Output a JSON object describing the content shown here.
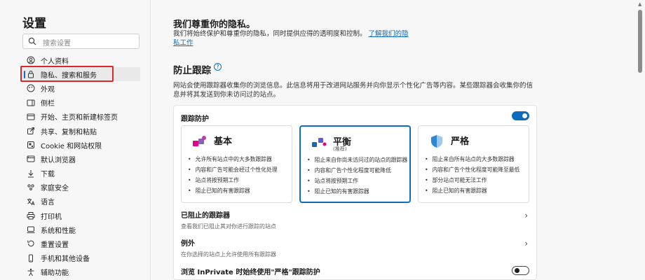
{
  "sidebar": {
    "title": "设置",
    "search_placeholder": "搜索设置",
    "items": [
      {
        "label": "个人资料",
        "icon": "profile-icon"
      },
      {
        "label": "隐私、搜索和服务",
        "icon": "lock-icon",
        "active": true
      },
      {
        "label": "外观",
        "icon": "appearance-icon"
      },
      {
        "label": "侧栏",
        "icon": "sidebar-icon"
      },
      {
        "label": "开始、主页和新建标签页",
        "icon": "home-icon"
      },
      {
        "label": "共享、复制和粘贴",
        "icon": "share-icon"
      },
      {
        "label": "Cookie 和网站权限",
        "icon": "cookie-icon"
      },
      {
        "label": "默认浏览器",
        "icon": "browser-icon"
      },
      {
        "label": "下载",
        "icon": "download-icon"
      },
      {
        "label": "家庭安全",
        "icon": "family-icon"
      },
      {
        "label": "语言",
        "icon": "language-icon"
      },
      {
        "label": "打印机",
        "icon": "printer-icon"
      },
      {
        "label": "系统和性能",
        "icon": "system-icon"
      },
      {
        "label": "重置设置",
        "icon": "reset-icon"
      },
      {
        "label": "手机和其他设备",
        "icon": "phone-icon"
      },
      {
        "label": "辅助功能",
        "icon": "accessibility-icon"
      }
    ]
  },
  "main": {
    "privacy_title": "我们尊重你的隐私。",
    "privacy_desc": "我们将始终保护和尊重你的隐私，同时提供应得的透明度和控制。",
    "privacy_link": "了解我们的隐私工作",
    "tracking_title": "防止跟踪",
    "tracking_help": "?",
    "tracking_desc": "网站会使用跟踪器收集你的浏览信息。此信息将用于改进网站服务并向你显示个性化广告等内容。某些跟踪器会收集你的信息并将其发送到你未访问过的站点。",
    "tracking_protection_label": "跟踪防护",
    "cards": [
      {
        "name": "基本",
        "sub": "",
        "bullets": [
          "允许所有站点中的大多数跟踪器",
          "内容和广告可能会经过个性化处理",
          "站点将按预期工作",
          "阻止已知的有害跟踪器"
        ]
      },
      {
        "name": "平衡",
        "sub": "(推荐)",
        "selected": true,
        "bullets": [
          "阻止来自你尚未访问过的站点的跟踪器",
          "内容和广告个性化程度可能降低",
          "站点将按预期工作",
          "阻止已知的有害跟踪器"
        ]
      },
      {
        "name": "严格",
        "sub": "",
        "bullets": [
          "阻止来自所有站点的大多数跟踪器",
          "内容和广告个性化程度可能降至最低",
          "部分站点可能无法工作",
          "阻止已知的有害跟踪器"
        ]
      }
    ],
    "blocked_title": "已阻止的跟踪器",
    "blocked_desc": "查看我们已阻止其对你进行跟踪的站点",
    "exceptions_title": "例外",
    "exceptions_desc": "在你选择的站点上允许使用所有跟踪器",
    "inprivate_title": "浏览 InPrivate 时始终使用\"严格\"跟踪防护",
    "chevron": "›",
    "colors": {
      "accent": "#0f6cbd",
      "highlight": "#d9262c"
    }
  }
}
